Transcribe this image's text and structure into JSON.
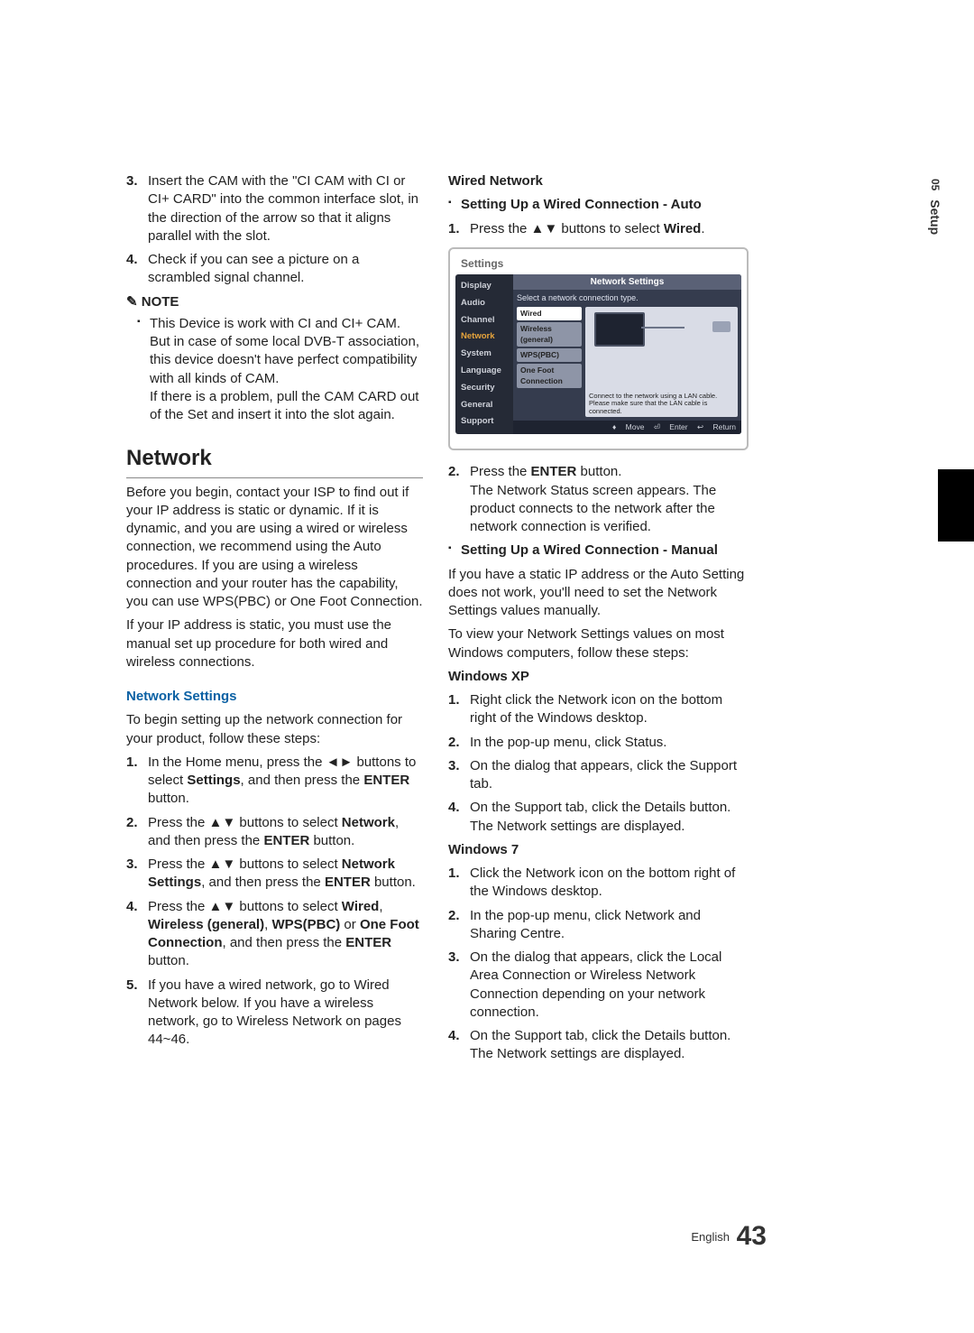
{
  "side_tab": {
    "chapter": "05",
    "title": "Setup"
  },
  "footer": {
    "lang": "English",
    "page": "43"
  },
  "left": {
    "items": [
      {
        "n": "3.",
        "t": "Insert the CAM with the \"CI CAM with CI or CI+ CARD\" into the common interface slot, in the direction of the arrow so that it aligns parallel with the slot."
      },
      {
        "n": "4.",
        "t": "Check if you can see a picture on a scrambled signal channel."
      }
    ],
    "note_label": "NOTE",
    "note_body1": "This Device is work with CI and CI+ CAM. But in case of some local DVB-T association, this device doesn't have perfect compatibility with all kinds of CAM.",
    "note_body2": "If there is a problem, pull the CAM CARD out of the Set and insert it into the slot again.",
    "section_title": "Network",
    "intro1": "Before you begin, contact your ISP to find out if your IP address is static or dynamic. If it is dynamic, and you are using a wired or wireless connection, we recommend using the Auto procedures. If you are using a wireless connection and your router has the capability, you can use WPS(PBC) or One Foot Connection.",
    "intro2": "If your IP address is static, you must use the manual set up procedure for both wired and wireless connections.",
    "sub1": "Network Settings",
    "sub1_lead": "To begin setting up the network connection for your product, follow these steps:",
    "steps": [
      {
        "n": "1.",
        "pre": "In the Home menu, press the ◄► buttons to select ",
        "b1": "Settings",
        "mid": ", and then press the ",
        "b2": "ENTER",
        "post": " button."
      },
      {
        "n": "2.",
        "pre": "Press the ▲▼ buttons to select ",
        "b1": "Network",
        "mid": ", and then press the ",
        "b2": "ENTER",
        "post": " button."
      },
      {
        "n": "3.",
        "pre": "Press the ▲▼ buttons to select ",
        "b1": "Network Settings",
        "mid": ", and then press the ",
        "b2": "ENTER",
        "post": " button."
      },
      {
        "n": "4.",
        "pre": "Press the ▲▼ buttons to select ",
        "b1": "Wired",
        "mid": ", ",
        "b2": "Wireless (general)",
        "mid2": ", ",
        "b3": "WPS(PBC)",
        "mid3": " or ",
        "b4": "One Foot Connection",
        "mid4": ", and then press the ",
        "b5": "ENTER",
        "post": " button."
      },
      {
        "n": "5.",
        "t": "If you have a wired network, go to Wired Network below. If you have a wireless network, go to Wireless Network on pages 44~46."
      }
    ]
  },
  "right": {
    "wired_title": "Wired Network",
    "wired_sub1": "Setting Up a Wired Connection - Auto",
    "wired_step1": {
      "n": "1.",
      "pre": "Press the ▲▼ buttons to select ",
      "b": "Wired",
      "post": "."
    },
    "panel": {
      "title": "Settings",
      "side": [
        "Display",
        "Audio",
        "Channel",
        "Network",
        "System",
        "Language",
        "Security",
        "General",
        "Support"
      ],
      "net_title": "Network Settings",
      "hint": "Select a network connection type.",
      "opts": [
        "Wired",
        "Wireless (general)",
        "WPS(PBC)",
        "One Foot Connection"
      ],
      "msg": "Connect to the network using a LAN cable. Please make sure that the LAN cable is connected.",
      "foot": {
        "move": "Move",
        "enter": "Enter",
        "ret": "Return"
      }
    },
    "wired_step2": {
      "n": "2.",
      "pre": "Press the ",
      "b": "ENTER",
      "post": " button.",
      "t2": "The Network Status screen appears. The product connects to the network after the network connection is verified."
    },
    "wired_sub2": "Setting Up a Wired Connection - Manual",
    "manual1": "If you have a static IP address or the Auto Setting does not work, you'll need to set the Network Settings values manually.",
    "manual2": "To view your Network Settings values on most Windows computers, follow these steps:",
    "xp_title": "Windows XP",
    "xp": [
      {
        "n": "1.",
        "t": "Right click the Network icon on the bottom right of the Windows desktop."
      },
      {
        "n": "2.",
        "t": "In the pop-up menu, click Status."
      },
      {
        "n": "3.",
        "t": "On the dialog that appears, click the Support tab."
      },
      {
        "n": "4.",
        "t": "On the Support tab, click the Details button. The Network settings are displayed."
      }
    ],
    "w7_title": "Windows 7",
    "w7": [
      {
        "n": "1.",
        "t": "Click the Network icon on the bottom right of the Windows desktop."
      },
      {
        "n": "2.",
        "t": "In the pop-up menu, click Network and Sharing Centre."
      },
      {
        "n": "3.",
        "t": "On the dialog that appears, click the Local Area Connection or Wireless Network Connection depending on your network connection."
      },
      {
        "n": "4.",
        "t": "On the Support tab, click the Details button. The Network settings are displayed."
      }
    ]
  }
}
